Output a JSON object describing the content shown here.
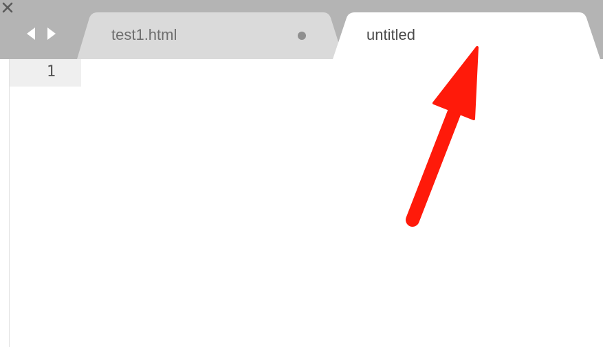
{
  "tabs": [
    {
      "title": "test1.html",
      "active": false,
      "modified": true
    },
    {
      "title": "untitled",
      "active": true,
      "modified": false
    }
  ],
  "nav": {
    "back_icon": "triangle-left",
    "forward_icon": "triangle-right"
  },
  "close_icon": "close-x",
  "editor": {
    "line_numbers": [
      "1"
    ]
  },
  "annotation": {
    "type": "arrow",
    "color": "#ff1a0a"
  },
  "colors": {
    "tab_bar_bg": "#b4b4b4",
    "inactive_tab_bg": "#dadada",
    "active_tab_bg": "#ffffff",
    "gutter_bg": "#efefef"
  }
}
